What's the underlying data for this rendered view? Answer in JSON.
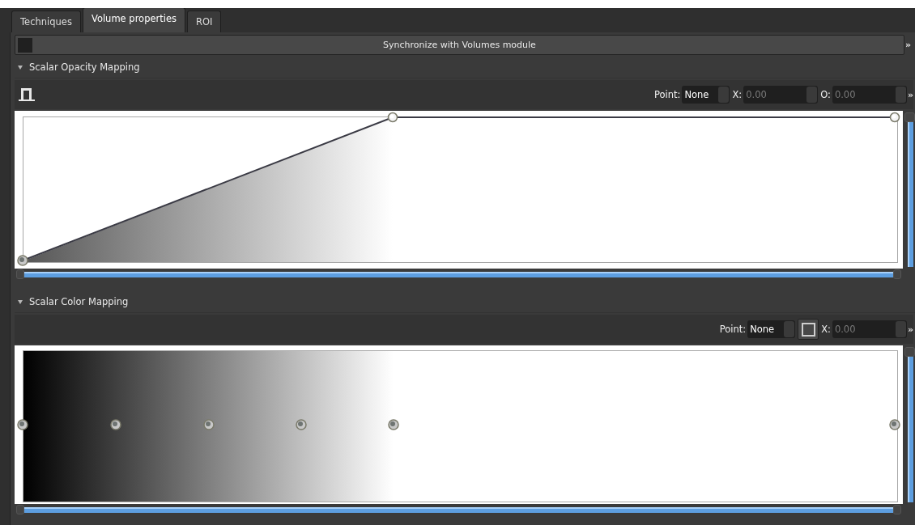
{
  "tabs": [
    {
      "label": "Techniques",
      "selected": false
    },
    {
      "label": "Volume properties",
      "selected": true
    },
    {
      "label": "ROI",
      "selected": false
    }
  ],
  "sync_button": {
    "label": "Synchronize with Volumes module",
    "checked": false,
    "more": "»"
  },
  "sections": [
    {
      "title": "Scalar Opacity Mapping",
      "expanded": true,
      "kind": "opacity",
      "more": "»",
      "x_range": {
        "level": 1
      },
      "y_range": {
        "level": 1
      },
      "controls": [
        {
          "kind": "spin",
          "label": "Point:",
          "value": "None",
          "disabled": false
        },
        {
          "kind": "spin",
          "label": "X:",
          "value": "0.00",
          "disabled": true
        },
        {
          "kind": "spin",
          "label": "O:",
          "value": "0.00",
          "disabled": true
        }
      ]
    },
    {
      "title": "Scalar Color Mapping",
      "expanded": true,
      "kind": "color",
      "more": "»",
      "x_range": {
        "level": 1
      },
      "y_range": {
        "level": 1
      },
      "controls": [
        {
          "kind": "spin",
          "label": "Point:",
          "value": "None",
          "disabled": false
        },
        {
          "kind": "swatch"
        },
        {
          "kind": "spin",
          "label": "X:",
          "value": "0.00",
          "disabled": true
        }
      ]
    }
  ]
}
